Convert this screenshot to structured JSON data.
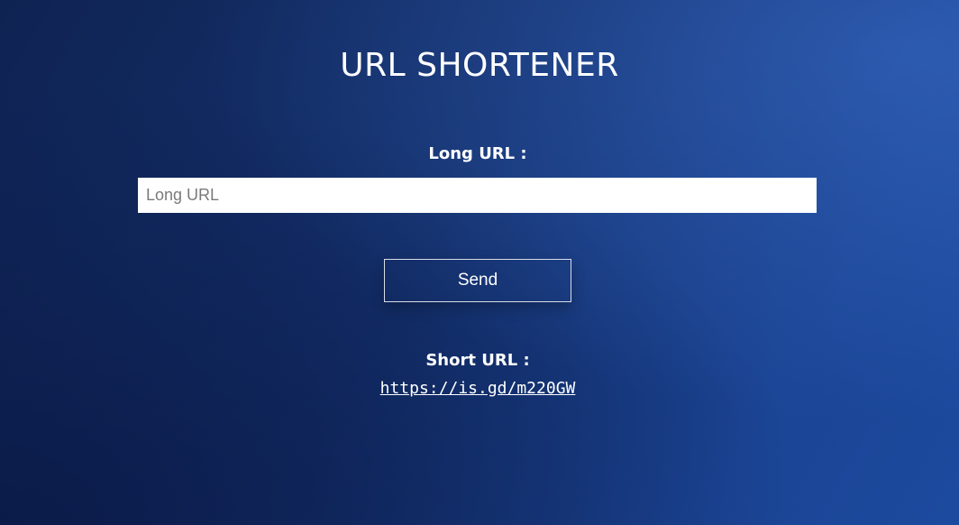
{
  "header": {
    "title": "URL SHORTENER"
  },
  "form": {
    "long_url_label": "Long URL :",
    "long_url_placeholder": "Long URL",
    "long_url_value": "",
    "send_label": "Send"
  },
  "result": {
    "short_url_label": "Short URL :",
    "short_url": "https://is.gd/m220GW"
  },
  "colors": {
    "background_dark": "#0f2352",
    "background_light": "#1c4a9e",
    "text": "#ffffff",
    "input_background": "#ffffff"
  }
}
